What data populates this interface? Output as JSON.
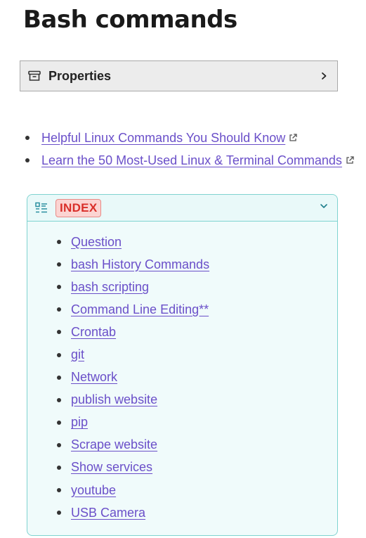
{
  "page": {
    "title": "Bash commands"
  },
  "properties": {
    "icon": "archive-box-icon",
    "label": "Properties",
    "expand_icon": "chevron-right-icon"
  },
  "links": [
    {
      "label": "Helpful Linux Commands You Should Know",
      "icon": "external-link-icon"
    },
    {
      "label": "Learn the 50 Most-Used Linux & Terminal Commands",
      "icon": "external-link-icon"
    }
  ],
  "index": {
    "icon": "list-icon",
    "badge": "INDEX",
    "toggle_icon": "chevron-down-icon",
    "items": [
      "Question",
      "bash History Commands",
      "bash scripting",
      "Command Line Editing**",
      "Crontab",
      "git",
      "Network",
      "publish website",
      "pip",
      "Scrape website",
      "Show services",
      "youtube",
      "USB Camera"
    ]
  },
  "colors": {
    "link": "#6a4fc9",
    "badge_text": "#d92f2a",
    "badge_bg": "#fbd4d2",
    "callout_border": "#7fd3d0",
    "callout_bg": "#f0fbfb"
  }
}
